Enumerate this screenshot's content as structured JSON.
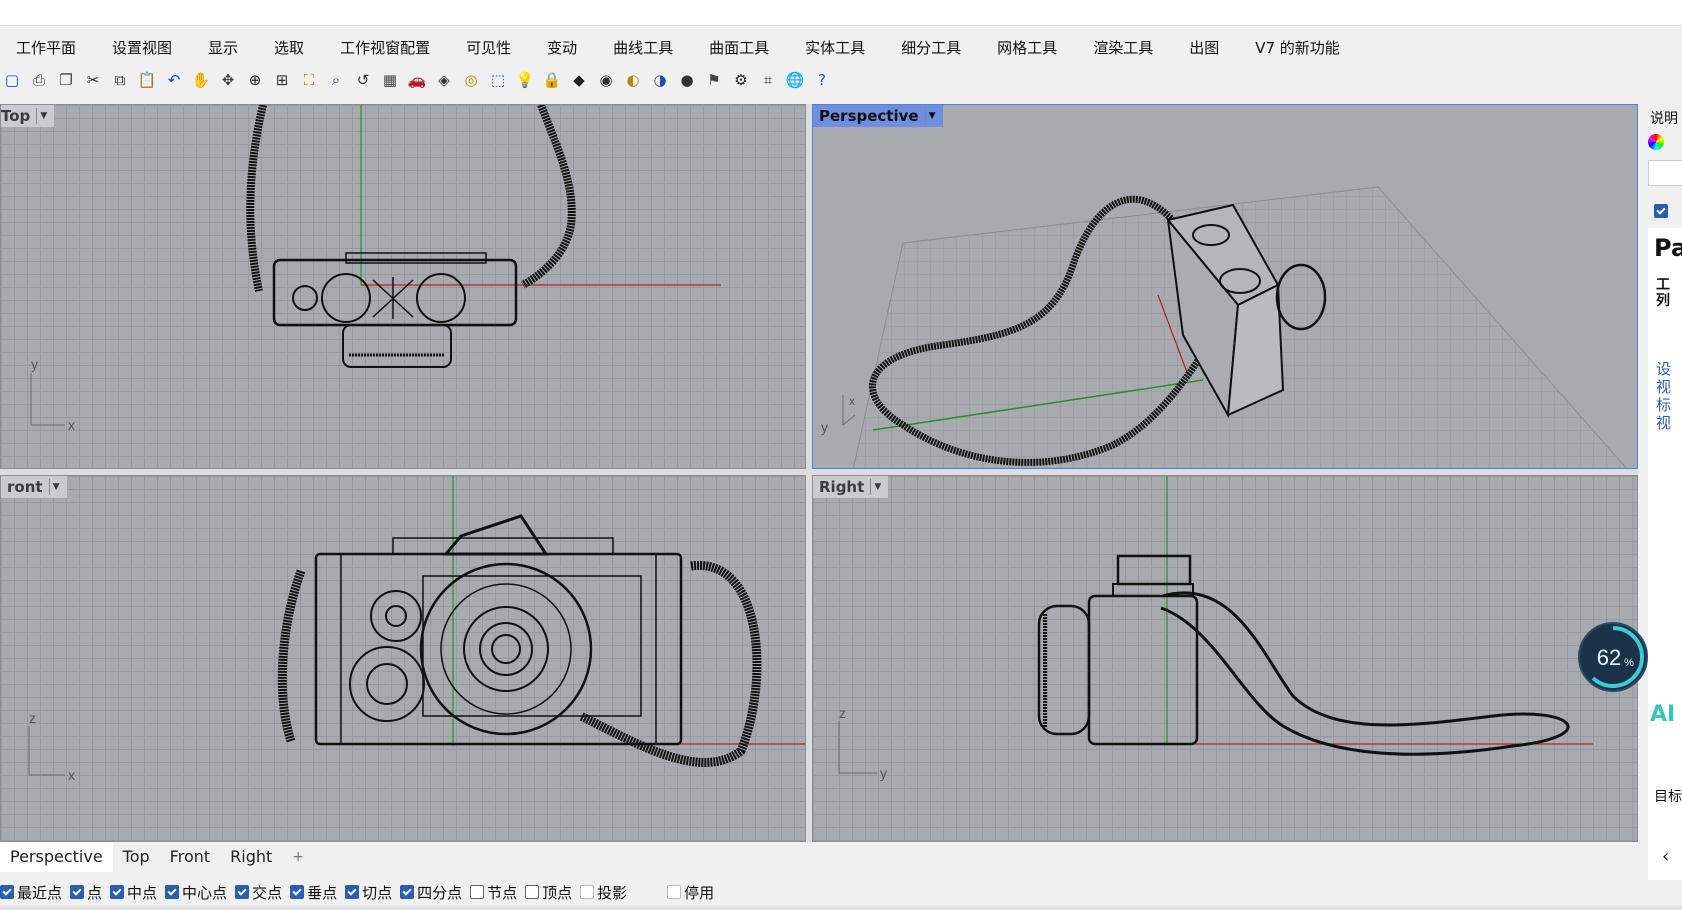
{
  "menu_tabs": [
    "工作平面",
    "设置视图",
    "显示",
    "选取",
    "工作视窗配置",
    "可见性",
    "变动",
    "曲线工具",
    "曲面工具",
    "实体工具",
    "细分工具",
    "网格工具",
    "渲染工具",
    "出图",
    "V7 的新功能"
  ],
  "toolbar_icons": [
    "new-icon",
    "print-icon",
    "copy-doc-icon",
    "cut-icon",
    "copy-icon",
    "paste-icon",
    "undo-icon",
    "pan-hand-icon",
    "rotate-view-icon",
    "zoom-icon",
    "zoom-window-icon",
    "zoom-extents-icon",
    "zoom-selected-icon",
    "undo-view-icon",
    "four-viewports-icon",
    "car-icon",
    "material-icon",
    "camera-icon",
    "select-icon",
    "light-icon",
    "lock-icon",
    "layer-icon",
    "color-wheel-icon",
    "shade-icon",
    "render-icon",
    "sphere-icon",
    "flag-icon",
    "gear-icon",
    "options-icon",
    "globe-icon",
    "help-icon"
  ],
  "viewports": {
    "top": {
      "label": "Top",
      "axis_h": "x",
      "axis_v": "y"
    },
    "perspective": {
      "label": "Perspective",
      "axis_h": "x",
      "axis_v": "y"
    },
    "front": {
      "label": "ront",
      "axis_h": "x",
      "axis_v": "z"
    },
    "right": {
      "label": "Right",
      "axis_h": "y",
      "axis_v": "z"
    }
  },
  "view_tabs": [
    "Perspective",
    "Top",
    "Front",
    "Right"
  ],
  "view_tab_add": "+",
  "snaps": [
    {
      "label": "最近点",
      "checked": true
    },
    {
      "label": "点",
      "checked": true
    },
    {
      "label": "中点",
      "checked": true
    },
    {
      "label": "中心点",
      "checked": true
    },
    {
      "label": "交点",
      "checked": true
    },
    {
      "label": "垂点",
      "checked": true
    },
    {
      "label": "切点",
      "checked": true
    },
    {
      "label": "四分点",
      "checked": true
    },
    {
      "label": "节点",
      "checked": false
    },
    {
      "label": "顶点",
      "checked": false
    },
    {
      "label": "投影",
      "checked": false
    },
    {
      "label": "停用",
      "checked": false
    }
  ],
  "right_panel": {
    "header": "说明",
    "title_partial": "Pa",
    "label_1": "工",
    "label_2": "列",
    "link_1": "设",
    "link_2": "视",
    "link_3": "标",
    "link_4": "视",
    "ai_text": "AI",
    "target_label": "目标"
  },
  "gauge": {
    "value": "62",
    "unit": "%",
    "fraction": 0.62
  }
}
